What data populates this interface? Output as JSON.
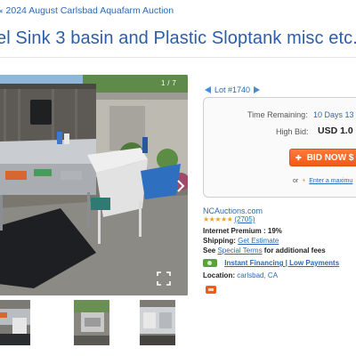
{
  "breadcrumb": {
    "arrow": "◂",
    "label": "2024 August Carlsbad Aquafarm Auction"
  },
  "title": "el Sink 3 basin and Plastic Sloptank misc etc.",
  "photo": {
    "counter": "1 / 7"
  },
  "lot": {
    "label": "Lot #1740"
  },
  "bid_box": {
    "time_remaining_label": "Time Remaining:",
    "time_remaining_value": "10 Days 13",
    "high_bid_label": "High Bid:",
    "high_bid_value": "USD 1.0",
    "bid_button_label": "BID NOW $",
    "or_text": "or",
    "max_link": "Enter a maximu"
  },
  "seller": {
    "name": "NCAuctions.com",
    "stars": "★★★★★",
    "review_count": "(2705)",
    "internet_premium": "Internet Premium : 19%",
    "shipping_label": "Shipping:",
    "shipping_value": "Get Estimate",
    "see_text": "See",
    "special_terms": "Special Terms",
    "fees_text": "for additional fees",
    "financing": "Instant Financing | Low Payments",
    "location_label": "Location:",
    "location_value": "carlsbad, CA"
  },
  "colors": {
    "link": "#2a6ab8",
    "title": "#2b5da8",
    "bid_button": "#f15a1a",
    "stars": "#f0a21c"
  }
}
